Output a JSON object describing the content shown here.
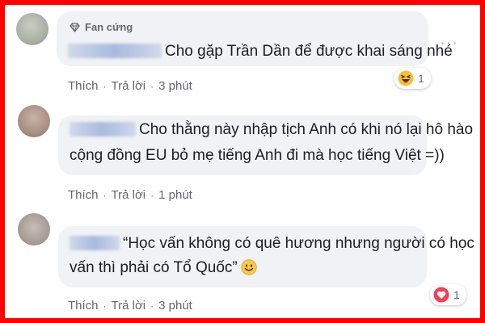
{
  "comments": [
    {
      "badge": "Fan cứng",
      "line1_suffix": "Cho gặp Trần Dần để được khai sáng nhé",
      "actions": {
        "like": "Thích",
        "reply": "Trả lời",
        "time": "3 phút"
      },
      "reaction": {
        "type": "haha",
        "count": "1"
      }
    },
    {
      "line1": "Cho thằng này nhập tịch Anh có khi nó lại hô hào",
      "line2": "cộng đồng EU bỏ mẹ tiếng Anh đi mà học tiếng Việt =))",
      "actions": {
        "like": "Thích",
        "reply": "Trả lời",
        "time": "1 phút"
      }
    },
    {
      "line1": "“Học vấn không có quê hương nhưng người có học",
      "line2": "vấn thì phải có Tổ Quốc”",
      "actions": {
        "like": "Thích",
        "reply": "Trả lời",
        "time": "3 phút"
      },
      "reaction": {
        "type": "love",
        "count": "1"
      }
    }
  ],
  "colors": {
    "frame": "#ff0000",
    "bubble": "#f0f2f5",
    "text": "#1c1e21",
    "meta": "#65676b"
  }
}
